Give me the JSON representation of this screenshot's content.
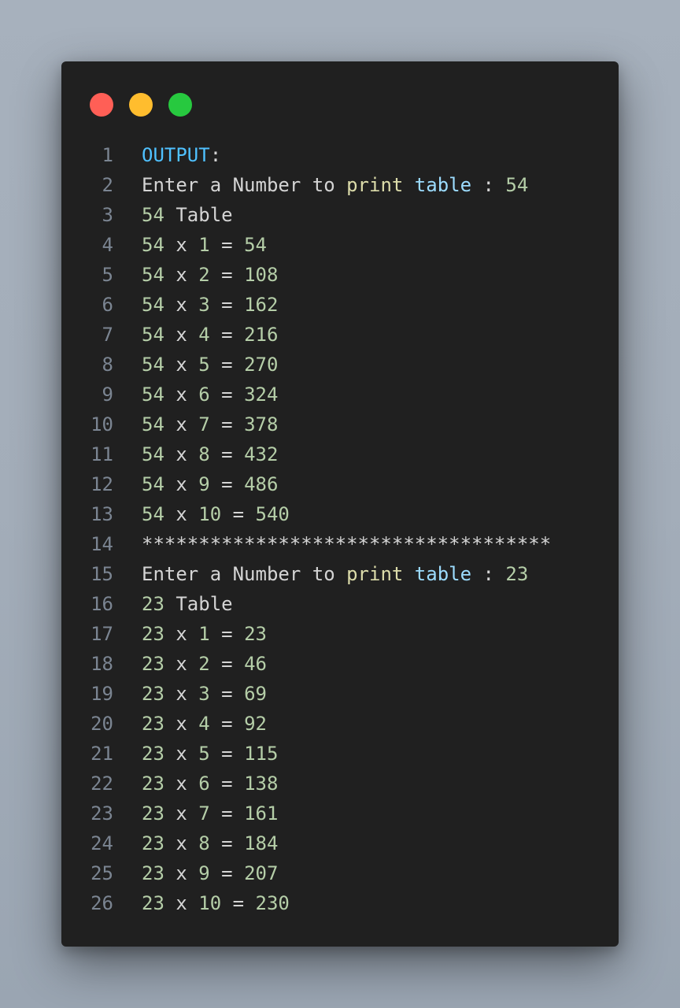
{
  "window": {
    "controls": [
      {
        "name": "close",
        "color": "#ff5f56"
      },
      {
        "name": "minimize",
        "color": "#ffbd2e"
      },
      {
        "name": "maximize",
        "color": "#27c93f"
      }
    ]
  },
  "colors": {
    "number": "#b5cea8",
    "plain": "#d4d4d4",
    "keyword": "#4fc1ff",
    "function": "#dcdcaa",
    "variable": "#9cdcfe",
    "line_number": "#7b8592"
  },
  "lines": [
    {
      "n": "1",
      "tokens": [
        {
          "t": "OUTPUT",
          "c": "kw"
        },
        {
          "t": ":",
          "c": "plain"
        }
      ]
    },
    {
      "n": "2",
      "tokens": [
        {
          "t": "Enter a Number to ",
          "c": "plain"
        },
        {
          "t": "print",
          "c": "fn"
        },
        {
          "t": " ",
          "c": "plain"
        },
        {
          "t": "table",
          "c": "var"
        },
        {
          "t": " : ",
          "c": "plain"
        },
        {
          "t": "54",
          "c": "num"
        }
      ]
    },
    {
      "n": "3",
      "tokens": [
        {
          "t": "54",
          "c": "num"
        },
        {
          "t": " Table",
          "c": "plain"
        }
      ]
    },
    {
      "n": "4",
      "tokens": [
        {
          "t": "54",
          "c": "num"
        },
        {
          "t": " x ",
          "c": "plain"
        },
        {
          "t": "1",
          "c": "num"
        },
        {
          "t": " = ",
          "c": "plain"
        },
        {
          "t": "54",
          "c": "num"
        }
      ]
    },
    {
      "n": "5",
      "tokens": [
        {
          "t": "54",
          "c": "num"
        },
        {
          "t": " x ",
          "c": "plain"
        },
        {
          "t": "2",
          "c": "num"
        },
        {
          "t": " = ",
          "c": "plain"
        },
        {
          "t": "108",
          "c": "num"
        }
      ]
    },
    {
      "n": "6",
      "tokens": [
        {
          "t": "54",
          "c": "num"
        },
        {
          "t": " x ",
          "c": "plain"
        },
        {
          "t": "3",
          "c": "num"
        },
        {
          "t": " = ",
          "c": "plain"
        },
        {
          "t": "162",
          "c": "num"
        }
      ]
    },
    {
      "n": "7",
      "tokens": [
        {
          "t": "54",
          "c": "num"
        },
        {
          "t": " x ",
          "c": "plain"
        },
        {
          "t": "4",
          "c": "num"
        },
        {
          "t": " = ",
          "c": "plain"
        },
        {
          "t": "216",
          "c": "num"
        }
      ]
    },
    {
      "n": "8",
      "tokens": [
        {
          "t": "54",
          "c": "num"
        },
        {
          "t": " x ",
          "c": "plain"
        },
        {
          "t": "5",
          "c": "num"
        },
        {
          "t": " = ",
          "c": "plain"
        },
        {
          "t": "270",
          "c": "num"
        }
      ]
    },
    {
      "n": "9",
      "tokens": [
        {
          "t": "54",
          "c": "num"
        },
        {
          "t": " x ",
          "c": "plain"
        },
        {
          "t": "6",
          "c": "num"
        },
        {
          "t": " = ",
          "c": "plain"
        },
        {
          "t": "324",
          "c": "num"
        }
      ]
    },
    {
      "n": "10",
      "tokens": [
        {
          "t": "54",
          "c": "num"
        },
        {
          "t": " x ",
          "c": "plain"
        },
        {
          "t": "7",
          "c": "num"
        },
        {
          "t": " = ",
          "c": "plain"
        },
        {
          "t": "378",
          "c": "num"
        }
      ]
    },
    {
      "n": "11",
      "tokens": [
        {
          "t": "54",
          "c": "num"
        },
        {
          "t": " x ",
          "c": "plain"
        },
        {
          "t": "8",
          "c": "num"
        },
        {
          "t": " = ",
          "c": "plain"
        },
        {
          "t": "432",
          "c": "num"
        }
      ]
    },
    {
      "n": "12",
      "tokens": [
        {
          "t": "54",
          "c": "num"
        },
        {
          "t": " x ",
          "c": "plain"
        },
        {
          "t": "9",
          "c": "num"
        },
        {
          "t": " = ",
          "c": "plain"
        },
        {
          "t": "486",
          "c": "num"
        }
      ]
    },
    {
      "n": "13",
      "tokens": [
        {
          "t": "54",
          "c": "num"
        },
        {
          "t": " x ",
          "c": "plain"
        },
        {
          "t": "10",
          "c": "num"
        },
        {
          "t": " = ",
          "c": "plain"
        },
        {
          "t": "540",
          "c": "num"
        }
      ]
    },
    {
      "n": "14",
      "tokens": [
        {
          "t": "************************************",
          "c": "plain"
        }
      ]
    },
    {
      "n": "15",
      "tokens": [
        {
          "t": "Enter a Number to ",
          "c": "plain"
        },
        {
          "t": "print",
          "c": "fn"
        },
        {
          "t": " ",
          "c": "plain"
        },
        {
          "t": "table",
          "c": "var"
        },
        {
          "t": " : ",
          "c": "plain"
        },
        {
          "t": "23",
          "c": "num"
        }
      ]
    },
    {
      "n": "16",
      "tokens": [
        {
          "t": "23",
          "c": "num"
        },
        {
          "t": " Table",
          "c": "plain"
        }
      ]
    },
    {
      "n": "17",
      "tokens": [
        {
          "t": "23",
          "c": "num"
        },
        {
          "t": " x ",
          "c": "plain"
        },
        {
          "t": "1",
          "c": "num"
        },
        {
          "t": " = ",
          "c": "plain"
        },
        {
          "t": "23",
          "c": "num"
        }
      ]
    },
    {
      "n": "18",
      "tokens": [
        {
          "t": "23",
          "c": "num"
        },
        {
          "t": " x ",
          "c": "plain"
        },
        {
          "t": "2",
          "c": "num"
        },
        {
          "t": " = ",
          "c": "plain"
        },
        {
          "t": "46",
          "c": "num"
        }
      ]
    },
    {
      "n": "19",
      "tokens": [
        {
          "t": "23",
          "c": "num"
        },
        {
          "t": " x ",
          "c": "plain"
        },
        {
          "t": "3",
          "c": "num"
        },
        {
          "t": " = ",
          "c": "plain"
        },
        {
          "t": "69",
          "c": "num"
        }
      ]
    },
    {
      "n": "20",
      "tokens": [
        {
          "t": "23",
          "c": "num"
        },
        {
          "t": " x ",
          "c": "plain"
        },
        {
          "t": "4",
          "c": "num"
        },
        {
          "t": " = ",
          "c": "plain"
        },
        {
          "t": "92",
          "c": "num"
        }
      ]
    },
    {
      "n": "21",
      "tokens": [
        {
          "t": "23",
          "c": "num"
        },
        {
          "t": " x ",
          "c": "plain"
        },
        {
          "t": "5",
          "c": "num"
        },
        {
          "t": " = ",
          "c": "plain"
        },
        {
          "t": "115",
          "c": "num"
        }
      ]
    },
    {
      "n": "22",
      "tokens": [
        {
          "t": "23",
          "c": "num"
        },
        {
          "t": " x ",
          "c": "plain"
        },
        {
          "t": "6",
          "c": "num"
        },
        {
          "t": " = ",
          "c": "plain"
        },
        {
          "t": "138",
          "c": "num"
        }
      ]
    },
    {
      "n": "23",
      "tokens": [
        {
          "t": "23",
          "c": "num"
        },
        {
          "t": " x ",
          "c": "plain"
        },
        {
          "t": "7",
          "c": "num"
        },
        {
          "t": " = ",
          "c": "plain"
        },
        {
          "t": "161",
          "c": "num"
        }
      ]
    },
    {
      "n": "24",
      "tokens": [
        {
          "t": "23",
          "c": "num"
        },
        {
          "t": " x ",
          "c": "plain"
        },
        {
          "t": "8",
          "c": "num"
        },
        {
          "t": " = ",
          "c": "plain"
        },
        {
          "t": "184",
          "c": "num"
        }
      ]
    },
    {
      "n": "25",
      "tokens": [
        {
          "t": "23",
          "c": "num"
        },
        {
          "t": " x ",
          "c": "plain"
        },
        {
          "t": "9",
          "c": "num"
        },
        {
          "t": " = ",
          "c": "plain"
        },
        {
          "t": "207",
          "c": "num"
        }
      ]
    },
    {
      "n": "26",
      "tokens": [
        {
          "t": "23",
          "c": "num"
        },
        {
          "t": " x ",
          "c": "plain"
        },
        {
          "t": "10",
          "c": "num"
        },
        {
          "t": " = ",
          "c": "plain"
        },
        {
          "t": "230",
          "c": "num"
        }
      ]
    }
  ]
}
